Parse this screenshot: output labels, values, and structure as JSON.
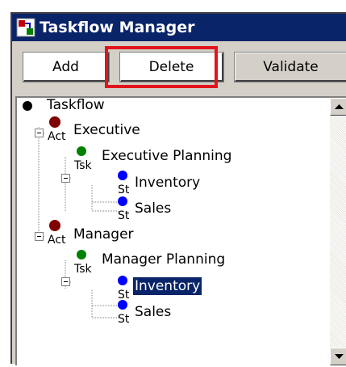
{
  "window": {
    "title": "Taskflow Manager",
    "title_bar_color": "#0a246a",
    "icon": "taskflow-app-icon"
  },
  "toolbar": {
    "add_label": "Add",
    "delete_label": "Delete",
    "validate_label": "Validate",
    "highlighted_button": "Delete",
    "highlight_color": "#e2141c"
  },
  "tree": {
    "root": {
      "label": "Taskflow",
      "icon": "black-dot-icon"
    },
    "nodes": [
      {
        "label": "Executive",
        "icon": "activity-icon",
        "icon_text": "Act",
        "icon_color": "#800000",
        "expanded": true
      },
      {
        "label": "Executive Planning",
        "icon": "task-icon",
        "icon_text": "Tsk",
        "icon_color": "#008000",
        "expanded": true
      },
      {
        "label": "Inventory",
        "icon": "step-icon",
        "icon_text": "St",
        "icon_color": "#0000ff",
        "selected": false
      },
      {
        "label": "Sales",
        "icon": "step-icon",
        "icon_text": "St",
        "icon_color": "#0000ff",
        "selected": false
      },
      {
        "label": "Manager",
        "icon": "activity-icon",
        "icon_text": "Act",
        "icon_color": "#800000",
        "expanded": true
      },
      {
        "label": "Manager Planning",
        "icon": "task-icon",
        "icon_text": "Tsk",
        "icon_color": "#008000",
        "expanded": true
      },
      {
        "label": "Inventory",
        "icon": "step-icon",
        "icon_text": "St",
        "icon_color": "#0000ff",
        "selected": true
      },
      {
        "label": "Sales",
        "icon": "step-icon",
        "icon_text": "St",
        "icon_color": "#0000ff",
        "selected": false
      }
    ]
  },
  "colors": {
    "selection": "#0a246a",
    "activity": "#800000",
    "task": "#008000",
    "step": "#0000ff"
  }
}
